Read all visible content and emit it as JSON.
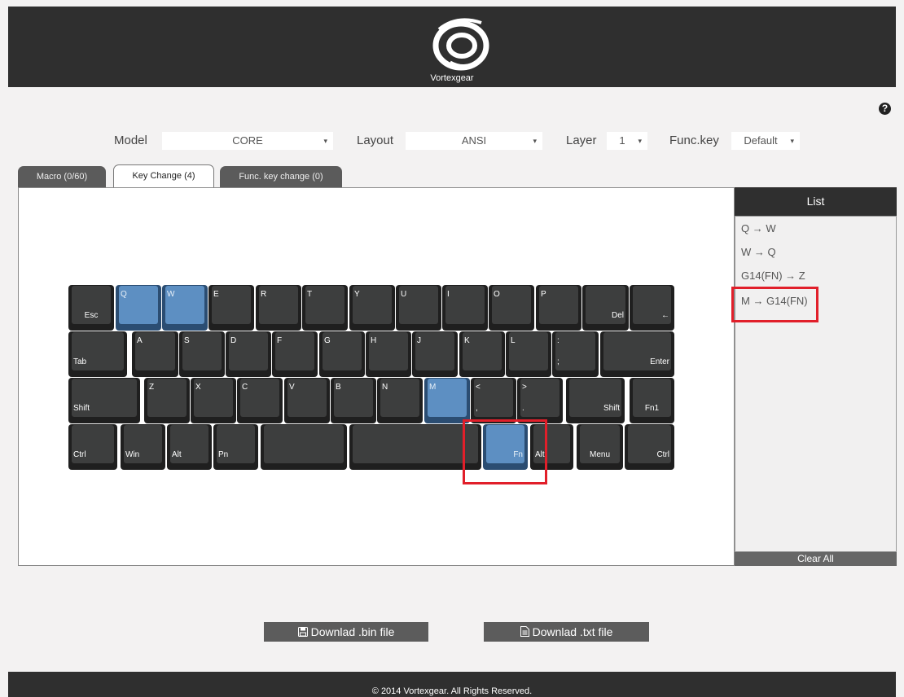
{
  "header": {
    "brand": "Vortexgear"
  },
  "controls": {
    "model_label": "Model",
    "model_value": "CORE",
    "layout_label": "Layout",
    "layout_value": "ANSI",
    "layer_label": "Layer",
    "layer_value": "1",
    "funckey_label": "Func.key",
    "funckey_value": "Default",
    "caret": "▾",
    "help": "?"
  },
  "tabs": [
    "Macro (0/60)",
    "Key Change (4)",
    "Func. key change (0)"
  ],
  "keyboard": {
    "rows": [
      [
        {
          "t": "",
          "b": "Esc",
          "align": "c"
        },
        {
          "t": "Q",
          "b": "",
          "blue": true
        },
        {
          "t": "W",
          "b": "",
          "blue": true
        },
        {
          "t": "E",
          "b": ""
        },
        {
          "t": "R",
          "b": ""
        },
        {
          "t": "T",
          "b": ""
        },
        {
          "t": "Y",
          "b": ""
        },
        {
          "t": "U",
          "b": ""
        },
        {
          "t": "I",
          "b": ""
        },
        {
          "t": "O",
          "b": ""
        },
        {
          "t": "P",
          "b": ""
        },
        {
          "t": "",
          "b": "Del",
          "align": "r"
        },
        {
          "t": "",
          "b": "←",
          "align": "r"
        }
      ],
      [
        {
          "t": "",
          "b": "Tab",
          "align": "l"
        },
        {
          "t": "A",
          "b": ""
        },
        {
          "t": "S",
          "b": ""
        },
        {
          "t": "D",
          "b": ""
        },
        {
          "t": "F",
          "b": ""
        },
        {
          "t": "G",
          "b": ""
        },
        {
          "t": "H",
          "b": ""
        },
        {
          "t": "J",
          "b": ""
        },
        {
          "t": "K",
          "b": ""
        },
        {
          "t": "L",
          "b": ""
        },
        {
          "t": ":",
          "b": ";",
          "align": "l"
        },
        {
          "t": "",
          "b": "Enter",
          "align": "r"
        }
      ],
      [
        {
          "t": "",
          "b": "Shift",
          "align": "l"
        },
        {
          "t": "Z",
          "b": ""
        },
        {
          "t": "X",
          "b": ""
        },
        {
          "t": "C",
          "b": ""
        },
        {
          "t": "V",
          "b": ""
        },
        {
          "t": "B",
          "b": ""
        },
        {
          "t": "N",
          "b": ""
        },
        {
          "t": "M",
          "b": "",
          "blue": true
        },
        {
          "t": "<",
          "b": ",",
          "align": "l"
        },
        {
          "t": ">",
          "b": ".",
          "align": "l"
        },
        {
          "t": "",
          "b": "Shift",
          "align": "r"
        },
        {
          "t": "",
          "b": "Fn1",
          "align": "c"
        }
      ],
      [
        {
          "t": "",
          "b": "Ctrl",
          "align": "l"
        },
        {
          "t": "",
          "b": "Win",
          "align": "l"
        },
        {
          "t": "",
          "b": "Alt",
          "align": "l"
        },
        {
          "t": "",
          "b": "Pn",
          "align": "l"
        },
        {
          "t": "",
          "b": ""
        },
        {
          "t": "",
          "b": ""
        },
        {
          "t": "",
          "b": "Fn",
          "align": "r",
          "blue": true
        },
        {
          "t": "",
          "b": "Alt",
          "align": "l"
        },
        {
          "t": "",
          "b": "Menu",
          "align": "c"
        },
        {
          "t": "",
          "b": "Ctrl",
          "align": "r"
        }
      ]
    ]
  },
  "list": {
    "title": "List",
    "items": [
      "Q → W",
      "W → Q",
      "G14(FN) → Z",
      "M → G14(FN)"
    ],
    "clear_all": "Clear All"
  },
  "downloads": {
    "bin": "Downlad .bin file",
    "txt": "Downlad .txt file"
  },
  "footer": {
    "copyright": "© 2014 Vortexgear. All Rights Reserved."
  },
  "colors": {
    "key_highlight": "#5d8fc2",
    "annotation": "#e11f2a",
    "header": "#2f2f2f"
  }
}
